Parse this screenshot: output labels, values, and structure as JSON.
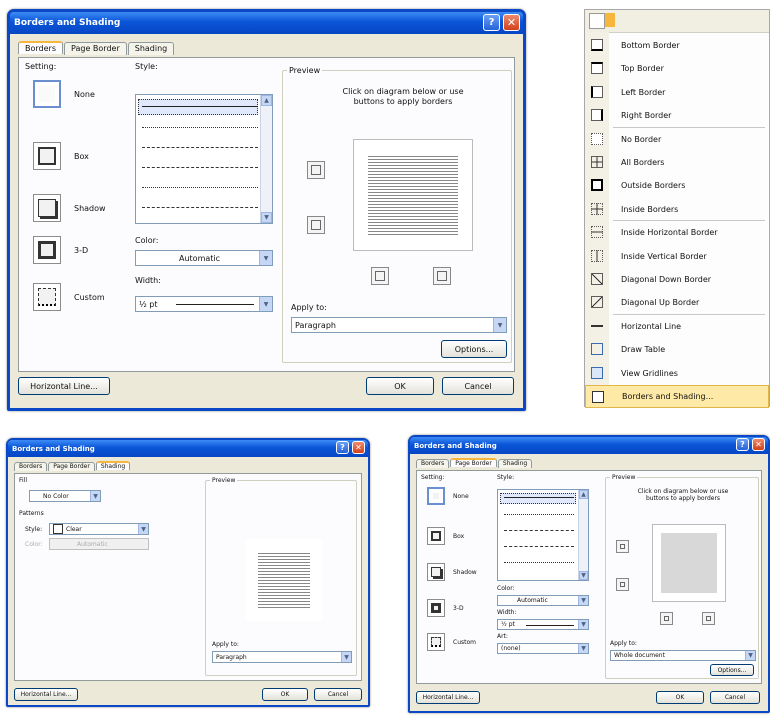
{
  "dialog_title": "Borders and Shading",
  "tabs": [
    "Borders",
    "Page Border",
    "Shading"
  ],
  "settings_label": "Setting:",
  "settings": [
    "None",
    "Box",
    "Shadow",
    "3-D",
    "Custom"
  ],
  "style_label": "Style:",
  "color_label": "Color:",
  "color_value": "Automatic",
  "width_label": "Width:",
  "width_value": "½ pt",
  "art_label": "Art:",
  "art_value": "(none)",
  "preview_label": "Preview",
  "preview_hint": "Click on diagram below or use buttons to apply borders",
  "apply_to_label": "Apply to:",
  "apply_to_paragraph": "Paragraph",
  "apply_to_whole": "Whole document",
  "options_label": "Options...",
  "horizontal_line_label": "Horizontal Line...",
  "ok_label": "OK",
  "cancel_label": "Cancel",
  "help_glyph": "?",
  "close_glyph": "✕",
  "shading": {
    "fill_label": "Fill",
    "fill_value": "No Color",
    "patterns_label": "Patterns",
    "style_label": "Style:",
    "style_value": "Clear",
    "color_label": "Color:",
    "color_value": "Automatic"
  },
  "menu_items": [
    "Bottom Border",
    "Top Border",
    "Left Border",
    "Right Border",
    "No Border",
    "All Borders",
    "Outside Borders",
    "Inside Borders",
    "Inside Horizontal Border",
    "Inside Vertical Border",
    "Diagonal Down Border",
    "Diagonal Up Border",
    "Horizontal Line",
    "Draw Table",
    "View Gridlines",
    "Borders and Shading..."
  ],
  "menu_icons": [
    "bottom-border-icon",
    "top-border-icon",
    "left-border-icon",
    "right-border-icon",
    "no-border-icon",
    "all-borders-icon",
    "outside-borders-icon",
    "inside-borders-icon",
    "inside-horizontal-border-icon",
    "inside-vertical-border-icon",
    "diagonal-down-border-icon",
    "diagonal-up-border-icon",
    "horizontal-line-icon",
    "draw-table-icon",
    "view-gridlines-icon",
    "borders-and-shading-icon"
  ],
  "colors": {
    "titlebar": "#0a55d8",
    "dialog_bg": "#ece9d8",
    "menu_highlight": "#ffe9a6",
    "close_button": "#d3401b"
  }
}
